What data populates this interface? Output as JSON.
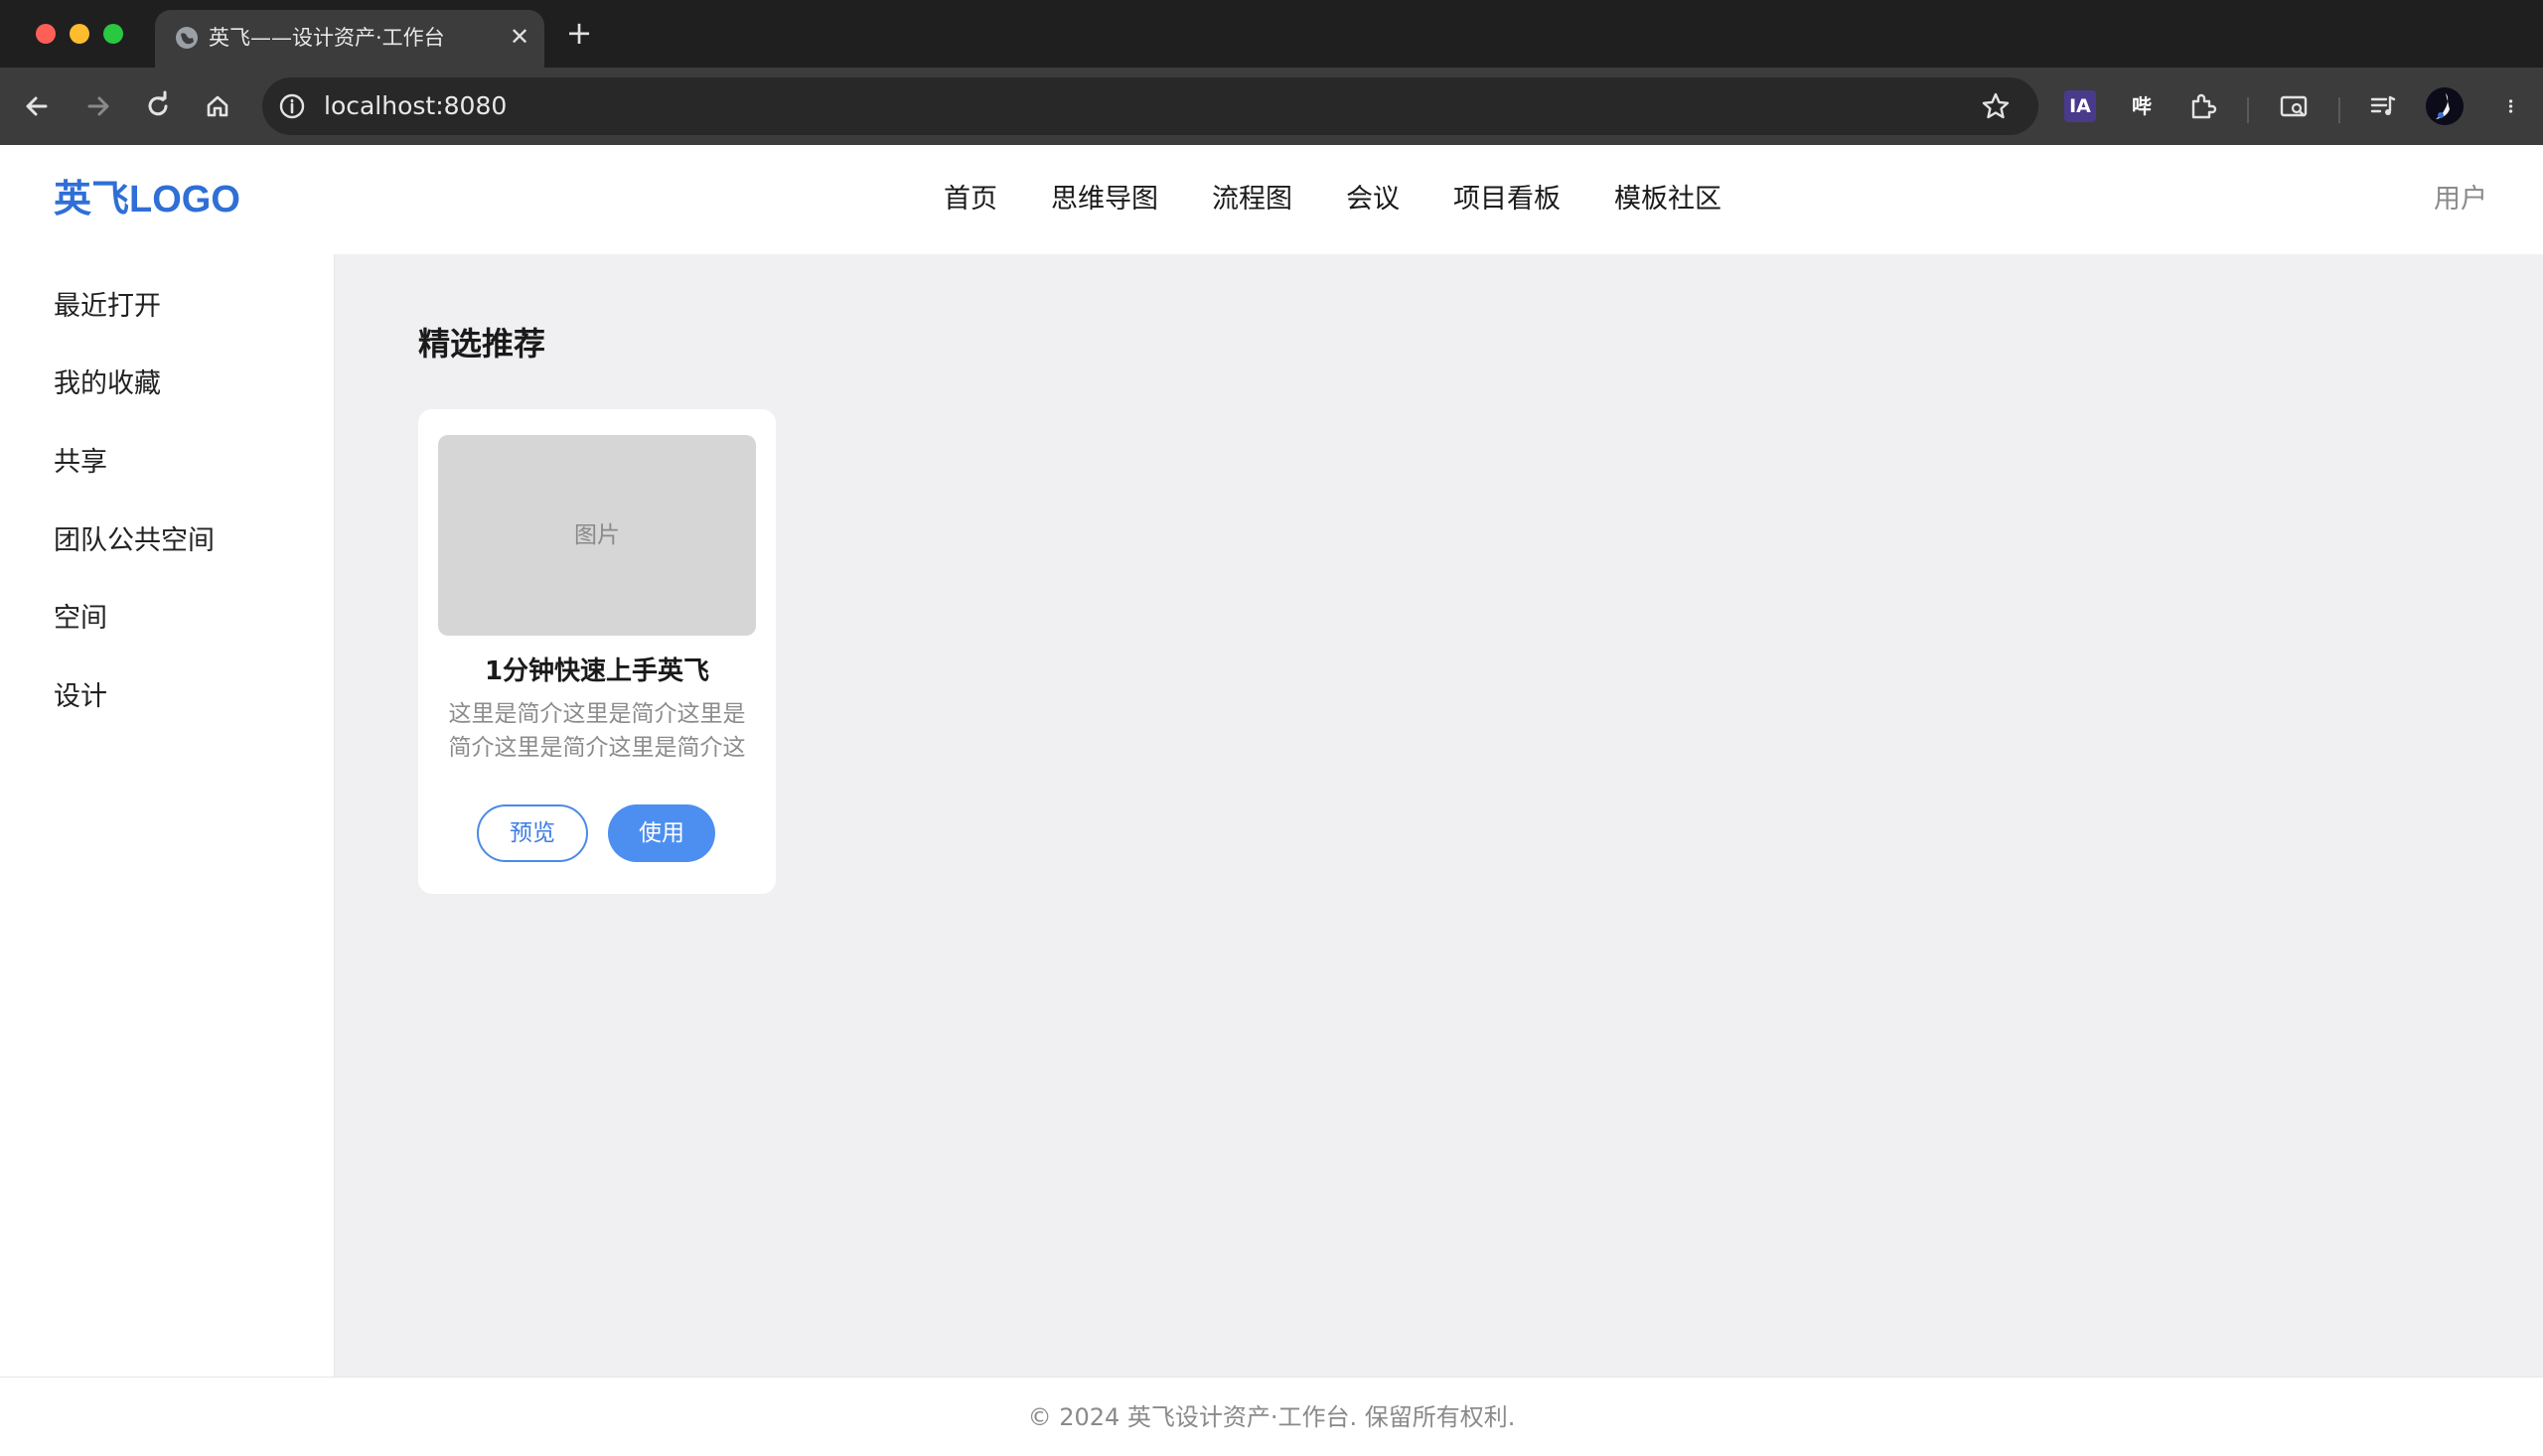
{
  "browser": {
    "tab_title": "英飞——设计资产·工作台",
    "url": "localhost:8080",
    "extensions": {
      "ia_label": "IA",
      "bi_label": "哔"
    }
  },
  "header": {
    "logo": "英飞LOGO",
    "nav": [
      "首页",
      "思维导图",
      "流程图",
      "会议",
      "项目看板",
      "模板社区"
    ],
    "user": "用户"
  },
  "sidebar": {
    "items": [
      "最近打开",
      "我的收藏",
      "共享",
      "团队公共空间",
      "空间",
      "设计"
    ]
  },
  "main": {
    "section_title": "精选推荐",
    "cards": [
      {
        "image_placeholder": "图片",
        "title": "1分钟快速上手英飞",
        "description": "这里是简介这里是简介这里是简介这里是简介这里是简介这",
        "preview_label": "预览",
        "use_label": "使用"
      }
    ]
  },
  "footer": {
    "text": "© 2024 英飞设计资产·工作台. 保留所有权利."
  },
  "colors": {
    "accent": "#2f6fd6",
    "button_primary": "#4d8ff0",
    "main_bg": "#f0f0f2"
  }
}
